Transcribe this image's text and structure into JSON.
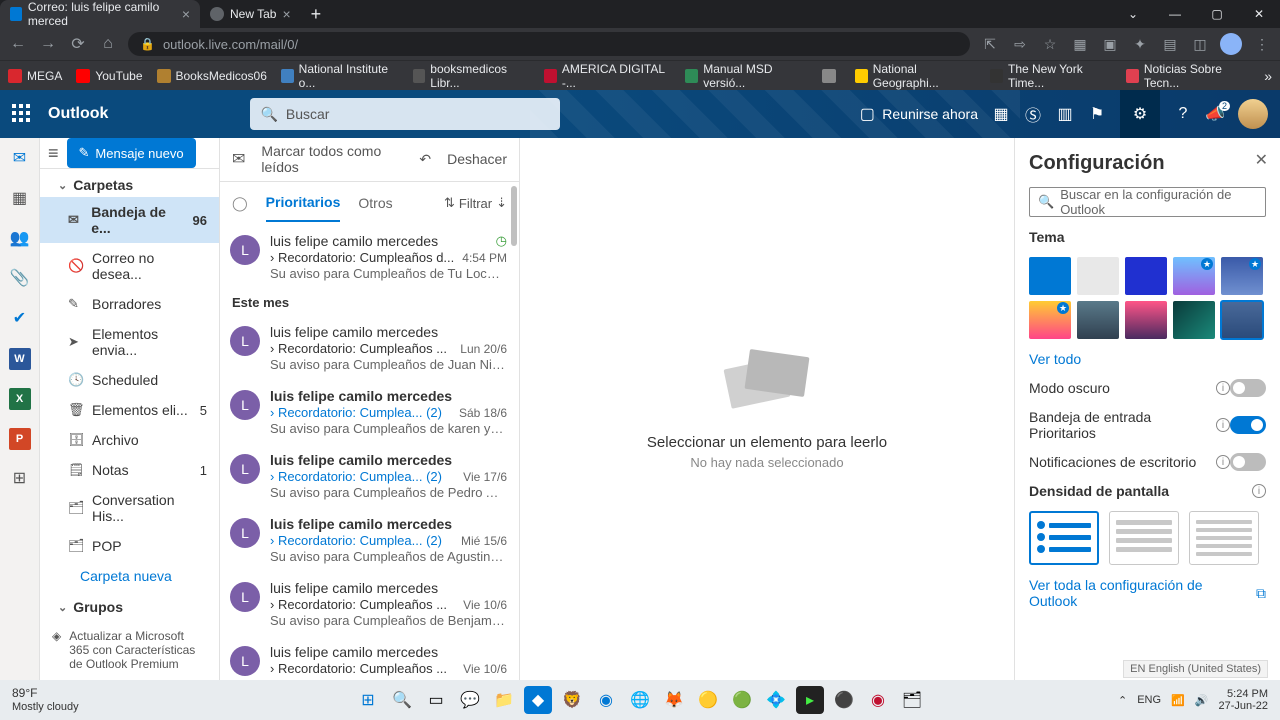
{
  "browser": {
    "tabs": [
      {
        "title": "Correo: luis felipe camilo merced",
        "active": true
      },
      {
        "title": "New Tab",
        "active": false
      }
    ],
    "url": "outlook.live.com/mail/0/"
  },
  "bookmarks": [
    {
      "label": "MEGA",
      "color": "#d9272e"
    },
    {
      "label": "YouTube",
      "color": "#ff0000"
    },
    {
      "label": "BooksMedicos06",
      "color": "#b08030"
    },
    {
      "label": "National Institute o...",
      "color": "#4080c0"
    },
    {
      "label": "booksmedicos Libr...",
      "color": "#555"
    },
    {
      "label": "AMERICA DIGITAL -...",
      "color": "#c01030"
    },
    {
      "label": "Manual MSD versió...",
      "color": "#2e8b57"
    },
    {
      "label": "",
      "color": "#888"
    },
    {
      "label": "National Geographi...",
      "color": "#ffcc00"
    },
    {
      "label": "The New York Time...",
      "color": "#333"
    },
    {
      "label": "Noticias Sobre Tecn...",
      "color": "#e04050"
    }
  ],
  "header": {
    "brand": "Outlook",
    "search_placeholder": "Buscar",
    "meet": "Reunirse ahora",
    "megaphone_badge": "2"
  },
  "commands": {
    "new_message": "Mensaje nuevo",
    "mark_read": "Marcar todos como leídos",
    "undo": "Deshacer"
  },
  "folders": {
    "section": "Carpetas",
    "items": [
      {
        "icon": "✉",
        "label": "Bandeja de e...",
        "count": "96",
        "selected": true
      },
      {
        "icon": "🚫",
        "label": "Correo no desea..."
      },
      {
        "icon": "✎",
        "label": "Borradores"
      },
      {
        "icon": "➤",
        "label": "Elementos envia..."
      },
      {
        "icon": "🕓",
        "label": "Scheduled"
      },
      {
        "icon": "🗑",
        "label": "Elementos eli...",
        "count": "5"
      },
      {
        "icon": "🗄",
        "label": "Archivo"
      },
      {
        "icon": "🗒",
        "label": "Notas",
        "count": "1"
      },
      {
        "icon": "🗂",
        "label": "Conversation His..."
      },
      {
        "icon": "🗂",
        "label": "POP"
      }
    ],
    "new_folder": "Carpeta nueva",
    "groups": "Grupos",
    "premium": "Actualizar a Microsoft 365 con Características de Outlook Premium"
  },
  "list": {
    "tab_focused": "Prioritarios",
    "tab_other": "Otros",
    "filter": "Filtrar",
    "group_this_month": "Este mes",
    "messages": [
      {
        "from": "luis felipe camilo mercedes",
        "subject": "Recordatorio: Cumpleaños d...",
        "time": "4:54 PM",
        "preview": "Su aviso para Cumpleaños de Tu Locotr...",
        "unread": false,
        "clock": true
      },
      {
        "from": "luis felipe camilo mercedes",
        "subject": "Recordatorio: Cumpleaños ...",
        "time": "Lun 20/6",
        "preview": "Su aviso para Cumpleaños de Juan Nicol...",
        "unread": false
      },
      {
        "from": "luis felipe camilo mercedes",
        "subject": "Recordatorio: Cumplea...   (2)",
        "time": "Sáb 18/6",
        "preview": "Su aviso para Cumpleaños de karen yaz...",
        "unread": true
      },
      {
        "from": "luis felipe camilo mercedes",
        "subject": "Recordatorio: Cumplea...   (2)",
        "time": "Vie 17/6",
        "preview": "Su aviso para Cumpleaños de Pedro Alej...",
        "unread": true
      },
      {
        "from": "luis felipe camilo mercedes",
        "subject": "Recordatorio: Cumplea...   (2)",
        "time": "Mié 15/6",
        "preview": "Su aviso para Cumpleaños de Agustin P...",
        "unread": true
      },
      {
        "from": "luis felipe camilo mercedes",
        "subject": "Recordatorio: Cumpleaños ...",
        "time": "Vie 10/6",
        "preview": "Su aviso para Cumpleaños de Benjamin ...",
        "unread": false
      },
      {
        "from": "luis felipe camilo mercedes",
        "subject": "Recordatorio: Cumpleaños ...",
        "time": "Vie 10/6",
        "preview": "",
        "unread": false
      }
    ]
  },
  "reading": {
    "title": "Seleccionar un elemento para leerlo",
    "subtitle": "No hay nada seleccionado"
  },
  "settings": {
    "title": "Configuración",
    "search_placeholder": "Buscar en la configuración de Outlook",
    "theme_label": "Tema",
    "themes": [
      {
        "bg": "#0078d4"
      },
      {
        "bg": "#e8e8e8"
      },
      {
        "bg": "#2030d0"
      },
      {
        "bg": "linear-gradient(#6fc0ff,#a060e0)",
        "star": true
      },
      {
        "bg": "linear-gradient(#3a5aa8,#7090d0)",
        "star": true
      },
      {
        "bg": "linear-gradient(#ffcc33,#ff4488)",
        "star": true
      },
      {
        "bg": "linear-gradient(#5a7a8a,#304050)"
      },
      {
        "bg": "linear-gradient(#ff5588,#4a2a60)"
      },
      {
        "bg": "linear-gradient(135deg,#0a3a3a,#1a8a7a)"
      },
      {
        "bg": "linear-gradient(#4a6a9a,#2a4a7a)",
        "selected": true
      }
    ],
    "see_all": "Ver todo",
    "dark_mode": "Modo oscuro",
    "focused_inbox": "Bandeja de entrada Prioritarios",
    "desktop_notifications": "Notificaciones de escritorio",
    "density": "Densidad de pantalla",
    "view_all": "Ver toda la configuración de Outlook",
    "language": "EN English (United States)"
  },
  "taskbar": {
    "temp": "89°F",
    "cond": "Mostly cloudy",
    "time": "5:24 PM",
    "date": "27-Jun-22"
  }
}
